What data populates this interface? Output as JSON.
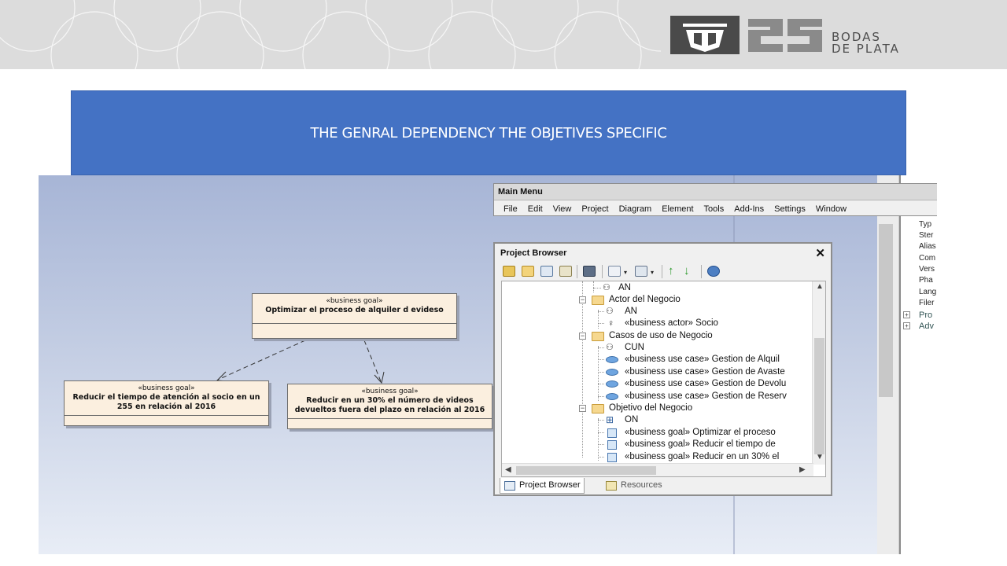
{
  "banner": {
    "logo_word1": "BODAS",
    "logo_word2": "DE PLATA",
    "logo_number": "25",
    "logo_icon": "university-shield-icon"
  },
  "title": "THE GENRAL DEPENDENCY THE OBJETIVES SPECIFIC",
  "diagram": {
    "goals": [
      {
        "stereotype": "«business goal»",
        "name": "Optimizar el proceso de alquiler d evideso"
      },
      {
        "stereotype": "«business goal»",
        "name": "Reducir el tiempo de atención al socio en un 255 en relación al 2016"
      },
      {
        "stereotype": "«business goal»",
        "name": "Reducir en un 30% el número de videos devueltos fuera del plazo en relación al 2016"
      }
    ]
  },
  "main_menu": {
    "title": "Main Menu",
    "items": [
      "File",
      "Edit",
      "View",
      "Project",
      "Diagram",
      "Element",
      "Tools",
      "Add-Ins",
      "Settings",
      "Window"
    ]
  },
  "project_browser": {
    "title": "Project Browser",
    "close": "✕",
    "tree": [
      {
        "label": "AN",
        "icon": "actor-group-icon"
      },
      {
        "label": "Actor del Negocio",
        "icon": "folder-icon"
      },
      {
        "label": "AN",
        "icon": "actor-group-icon"
      },
      {
        "label": "«business actor» Socio",
        "icon": "actor-icon"
      },
      {
        "label": "Casos de uso de Negocio",
        "icon": "folder-icon"
      },
      {
        "label": "CUN",
        "icon": "actor-group-icon"
      },
      {
        "label": "«business use case» Gestion de Alquil",
        "icon": "use-case-icon"
      },
      {
        "label": "«business use case» Gestion de Avaste",
        "icon": "use-case-icon"
      },
      {
        "label": "«business use case» Gestion de Devolu",
        "icon": "use-case-icon"
      },
      {
        "label": "«business use case» Gestion de Reserv",
        "icon": "use-case-icon"
      },
      {
        "label": "Objetivo del Negocio",
        "icon": "folder-icon"
      },
      {
        "label": "ON",
        "icon": "diagram-icon"
      },
      {
        "label": "«business goal» Optimizar el proceso",
        "icon": "goal-icon"
      },
      {
        "label": "«business goal» Reducir el tiempo de",
        "icon": "goal-icon"
      },
      {
        "label": "«business goal» Reducir en un 30% el",
        "icon": "goal-icon"
      }
    ],
    "tabs": [
      {
        "label": "Project Browser",
        "active": true
      },
      {
        "label": "Resources",
        "active": false
      }
    ]
  },
  "properties": {
    "items": [
      "Typ",
      "Ster",
      "Alias",
      "Com",
      "Vers",
      "Pha",
      "Lang",
      "Filer",
      "Pro",
      "Adv"
    ]
  },
  "colors": {
    "title_bg": "#4472c4",
    "goal_fill": "#fbefdf",
    "banner_bg": "#dcdcdc"
  }
}
